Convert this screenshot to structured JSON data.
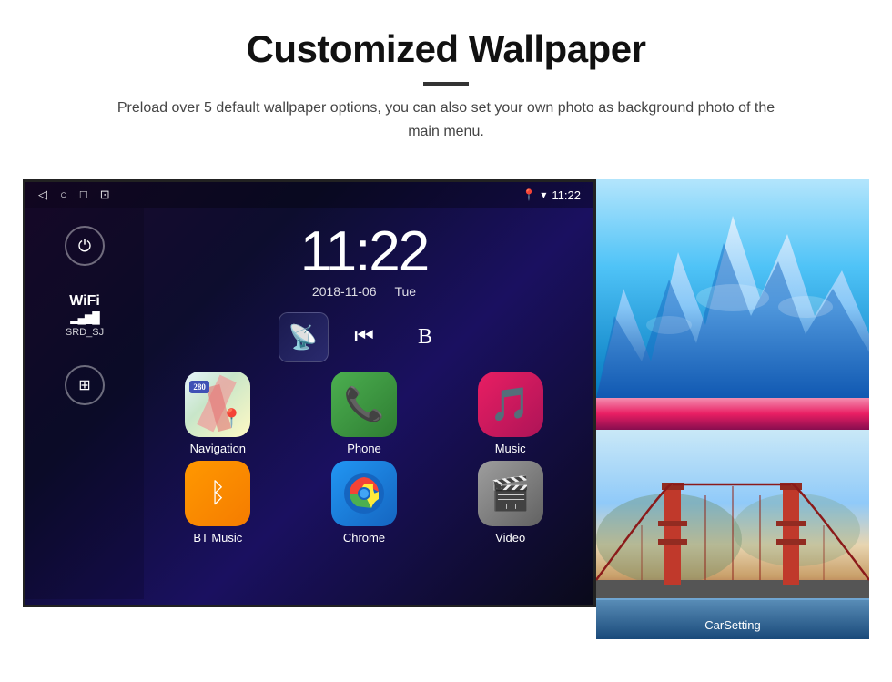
{
  "header": {
    "title": "Customized Wallpaper",
    "subtitle": "Preload over 5 default wallpaper options, you can also set your own photo as background photo of the main menu."
  },
  "screen": {
    "time": "11:22",
    "date_left": "2018-11-06",
    "date_right": "Tue",
    "nav_icons": [
      "◁",
      "○",
      "□",
      "⊡"
    ],
    "status_icons": [
      "📍",
      "▾"
    ],
    "wifi": {
      "label": "WiFi",
      "ssid": "SRD_SJ"
    },
    "apps": [
      {
        "name": "Navigation",
        "icon_type": "maps"
      },
      {
        "name": "Phone",
        "icon_type": "phone"
      },
      {
        "name": "Music",
        "icon_type": "music"
      },
      {
        "name": "BT Music",
        "icon_type": "bluetooth"
      },
      {
        "name": "Chrome",
        "icon_type": "chrome"
      },
      {
        "name": "Video",
        "icon_type": "video"
      }
    ],
    "car_setting_label": "CarSetting"
  }
}
